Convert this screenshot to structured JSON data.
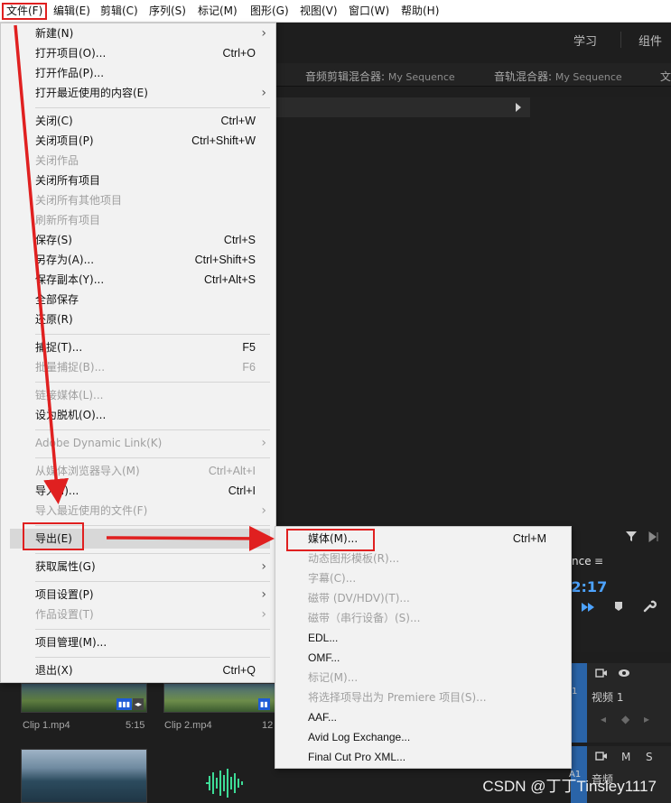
{
  "menubar": {
    "items": [
      "文件(F)",
      "编辑(E)",
      "剪辑(C)",
      "序列(S)",
      "标记(M)",
      "图形(G)",
      "视图(V)",
      "窗口(W)",
      "帮助(H)"
    ]
  },
  "workspace": {
    "tabs": [
      "学习",
      "组件"
    ]
  },
  "panels": {
    "audio_clip_mixer": "音频剪辑混合器:",
    "audio_clip_mixer_seq": "My Sequence",
    "audio_track_mixer": "音轨混合器:",
    "audio_track_mixer_seq": "My Sequence",
    "overflow": "文"
  },
  "timeline": {
    "tab_fragment": "nce",
    "menu_glyph": "≡",
    "timecode": ":2:17",
    "video_track_id": "1",
    "video_track": "视频 1",
    "audio_track_id": "A1",
    "audio_track": "音频",
    "m_label": "M",
    "s_label": "S"
  },
  "bin": {
    "clip1": {
      "name": "Clip 1.mp4",
      "duration": "5:15"
    },
    "clip2": {
      "name": "Clip 2.mp4",
      "duration": "12"
    }
  },
  "file_menu": {
    "items": [
      {
        "label": "新建(N)",
        "shortcut": "",
        "submenu": true,
        "disabled": false
      },
      {
        "label": "打开项目(O)...",
        "shortcut": "Ctrl+O",
        "submenu": false,
        "disabled": false
      },
      {
        "label": "打开作品(P)...",
        "shortcut": "",
        "submenu": false,
        "disabled": false
      },
      {
        "label": "打开最近使用的内容(E)",
        "shortcut": "",
        "submenu": true,
        "disabled": false
      },
      {
        "label": "关闭(C)",
        "shortcut": "Ctrl+W",
        "submenu": false,
        "disabled": false
      },
      {
        "label": "关闭项目(P)",
        "shortcut": "Ctrl+Shift+W",
        "submenu": false,
        "disabled": false
      },
      {
        "label": "关闭作品",
        "shortcut": "",
        "submenu": false,
        "disabled": true
      },
      {
        "label": "关闭所有项目",
        "shortcut": "",
        "submenu": false,
        "disabled": false
      },
      {
        "label": "关闭所有其他项目",
        "shortcut": "",
        "submenu": false,
        "disabled": true
      },
      {
        "label": "刷新所有项目",
        "shortcut": "",
        "submenu": false,
        "disabled": true
      },
      {
        "label": "保存(S)",
        "shortcut": "Ctrl+S",
        "submenu": false,
        "disabled": false
      },
      {
        "label": "另存为(A)...",
        "shortcut": "Ctrl+Shift+S",
        "submenu": false,
        "disabled": false
      },
      {
        "label": "保存副本(Y)...",
        "shortcut": "Ctrl+Alt+S",
        "submenu": false,
        "disabled": false
      },
      {
        "label": "全部保存",
        "shortcut": "",
        "submenu": false,
        "disabled": false
      },
      {
        "label": "还原(R)",
        "shortcut": "",
        "submenu": false,
        "disabled": false
      },
      {
        "label": "捕捉(T)...",
        "shortcut": "F5",
        "submenu": false,
        "disabled": false
      },
      {
        "label": "批量捕捉(B)...",
        "shortcut": "F6",
        "submenu": false,
        "disabled": true
      },
      {
        "label": "链接媒体(L)...",
        "shortcut": "",
        "submenu": false,
        "disabled": true
      },
      {
        "label": "设为脱机(O)...",
        "shortcut": "",
        "submenu": false,
        "disabled": false
      },
      {
        "label": "Adobe Dynamic Link(K)",
        "shortcut": "",
        "submenu": true,
        "disabled": true
      },
      {
        "label": "从媒体浏览器导入(M)",
        "shortcut": "Ctrl+Alt+I",
        "submenu": false,
        "disabled": true
      },
      {
        "label": "导入(I)...",
        "shortcut": "Ctrl+I",
        "submenu": false,
        "disabled": false
      },
      {
        "label": "导入最近使用的文件(F)",
        "shortcut": "",
        "submenu": true,
        "disabled": true
      },
      {
        "label": "导出(E)",
        "shortcut": "",
        "submenu": true,
        "disabled": false
      },
      {
        "label": "获取属性(G)",
        "shortcut": "",
        "submenu": true,
        "disabled": false
      },
      {
        "label": "项目设置(P)",
        "shortcut": "",
        "submenu": true,
        "disabled": false
      },
      {
        "label": "作品设置(T)",
        "shortcut": "",
        "submenu": true,
        "disabled": true
      },
      {
        "label": "项目管理(M)...",
        "shortcut": "",
        "submenu": false,
        "disabled": false
      },
      {
        "label": "退出(X)",
        "shortcut": "Ctrl+Q",
        "submenu": false,
        "disabled": false
      }
    ]
  },
  "export_menu": {
    "items": [
      {
        "label": "媒体(M)...",
        "shortcut": "Ctrl+M",
        "disabled": false
      },
      {
        "label": "动态图形模板(R)...",
        "shortcut": "",
        "disabled": true
      },
      {
        "label": "字幕(C)...",
        "shortcut": "",
        "disabled": true
      },
      {
        "label": "磁带 (DV/HDV)(T)...",
        "shortcut": "",
        "disabled": true
      },
      {
        "label": "磁带（串行设备）(S)...",
        "shortcut": "",
        "disabled": true
      },
      {
        "label": "EDL...",
        "shortcut": "",
        "disabled": false
      },
      {
        "label": "OMF...",
        "shortcut": "",
        "disabled": false
      },
      {
        "label": "标记(M)...",
        "shortcut": "",
        "disabled": true
      },
      {
        "label": "将选择项导出为 Premiere 项目(S)...",
        "shortcut": "",
        "disabled": true
      },
      {
        "label": "AAF...",
        "shortcut": "",
        "disabled": false
      },
      {
        "label": "Avid Log Exchange...",
        "shortcut": "",
        "disabled": false
      },
      {
        "label": "Final Cut Pro XML...",
        "shortcut": "",
        "disabled": false
      }
    ]
  },
  "watermark": "CSDN @丁丁Tinsley1117",
  "colors": {
    "annotation_red": "#e02020",
    "accent_blue": "#4da3ff"
  }
}
